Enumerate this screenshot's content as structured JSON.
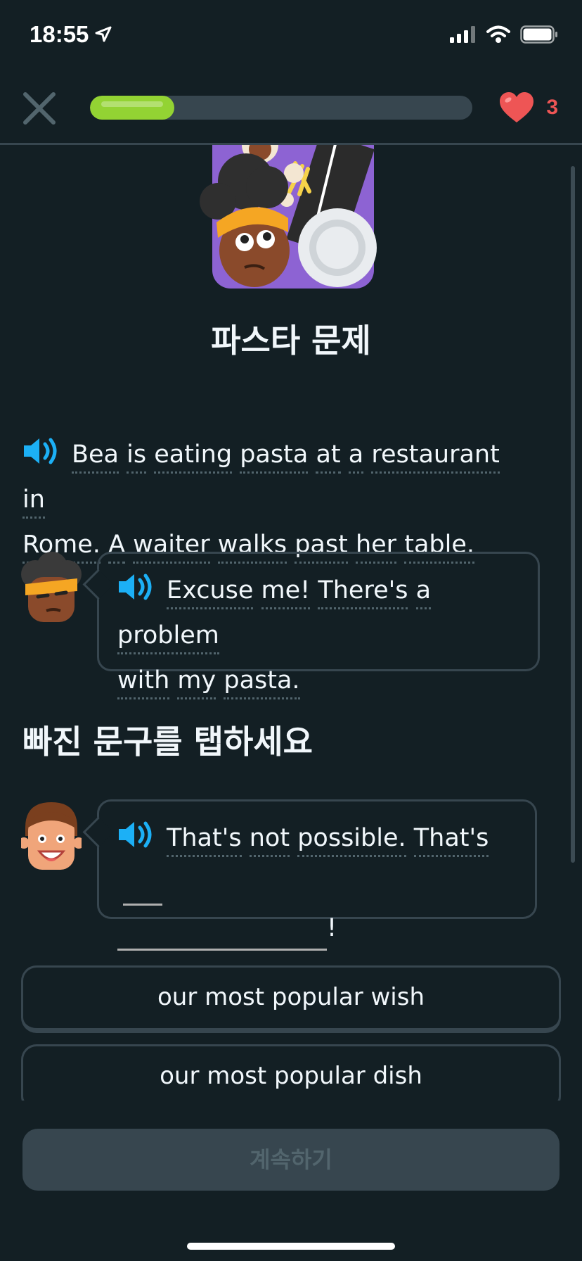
{
  "status": {
    "time": "18:55"
  },
  "progress": {
    "fraction": 0.22
  },
  "hearts": {
    "count": "3"
  },
  "story": {
    "title": "파스타 문제",
    "narration_words": [
      "Bea",
      "is",
      "eating",
      "pasta",
      "at",
      "a",
      "restaurant",
      "in",
      "Rome.",
      "A",
      "waiter",
      "walks",
      "past",
      "her",
      "table."
    ],
    "line1_words": [
      "Excuse",
      "me!",
      "There's",
      "a",
      "problem",
      "with",
      "my",
      "pasta."
    ],
    "instruction": "빠진 문구를 탭하세요",
    "line2_words": [
      "That's",
      "not",
      "possible.",
      "That's"
    ],
    "line2_end": "!"
  },
  "options": [
    {
      "label": "our most popular wish"
    },
    {
      "label": "our most popular dish"
    }
  ],
  "footer": {
    "continue_label": "계속하기"
  },
  "colors": {
    "background": "#131f24",
    "progress": "#93d333",
    "heart": "#ee5555",
    "speaker": "#1cb0f6",
    "border": "#37464f"
  }
}
